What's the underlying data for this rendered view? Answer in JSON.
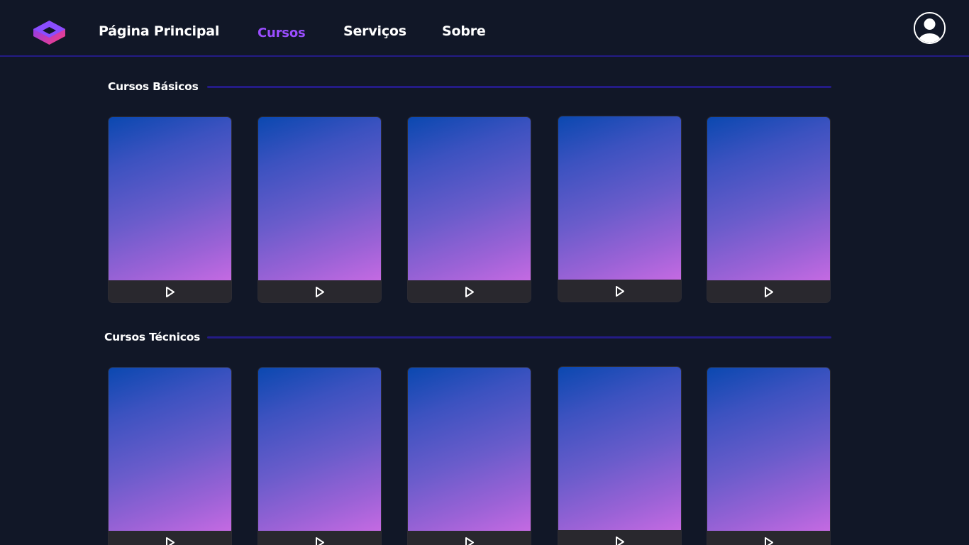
{
  "header": {
    "logo_icon": "hexagon-logo-icon",
    "nav": [
      {
        "label": "Página Principal",
        "active": false
      },
      {
        "label": "Cursos",
        "active": true
      },
      {
        "label": "Serviços",
        "active": false
      },
      {
        "label": "Sobre",
        "active": false
      }
    ],
    "avatar_icon": "user-avatar-icon"
  },
  "colors": {
    "background": "#111727",
    "accent": "#9a4dff",
    "divider": "#241b86",
    "card_footer": "#29282e"
  },
  "sections": [
    {
      "title": "Cursos Básicos",
      "card_count": 5,
      "card_icon": "play-icon"
    },
    {
      "title": "Cursos Técnicos",
      "card_count": 5,
      "card_icon": "play-icon"
    }
  ]
}
